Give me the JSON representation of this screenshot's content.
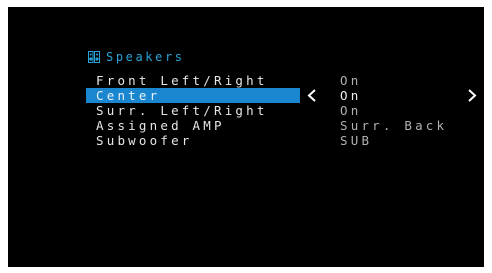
{
  "menu": {
    "title": "Speakers",
    "title_icon": "speaker-icon",
    "items": [
      {
        "label": "Front Left/Right",
        "value": "On"
      },
      {
        "label": "Center",
        "value": "On"
      },
      {
        "label": "Surr. Left/Right",
        "value": "On"
      },
      {
        "label": "Assigned AMP",
        "value": "Surr. Back"
      },
      {
        "label": "Subwoofer",
        "value": "SUB"
      }
    ],
    "selected_index": 1
  },
  "colors": {
    "background": "#000000",
    "title": "#2aa3d8",
    "highlight": "#1a86cf",
    "text": "#e6e6e6",
    "value_text": "#b0b0b0"
  }
}
